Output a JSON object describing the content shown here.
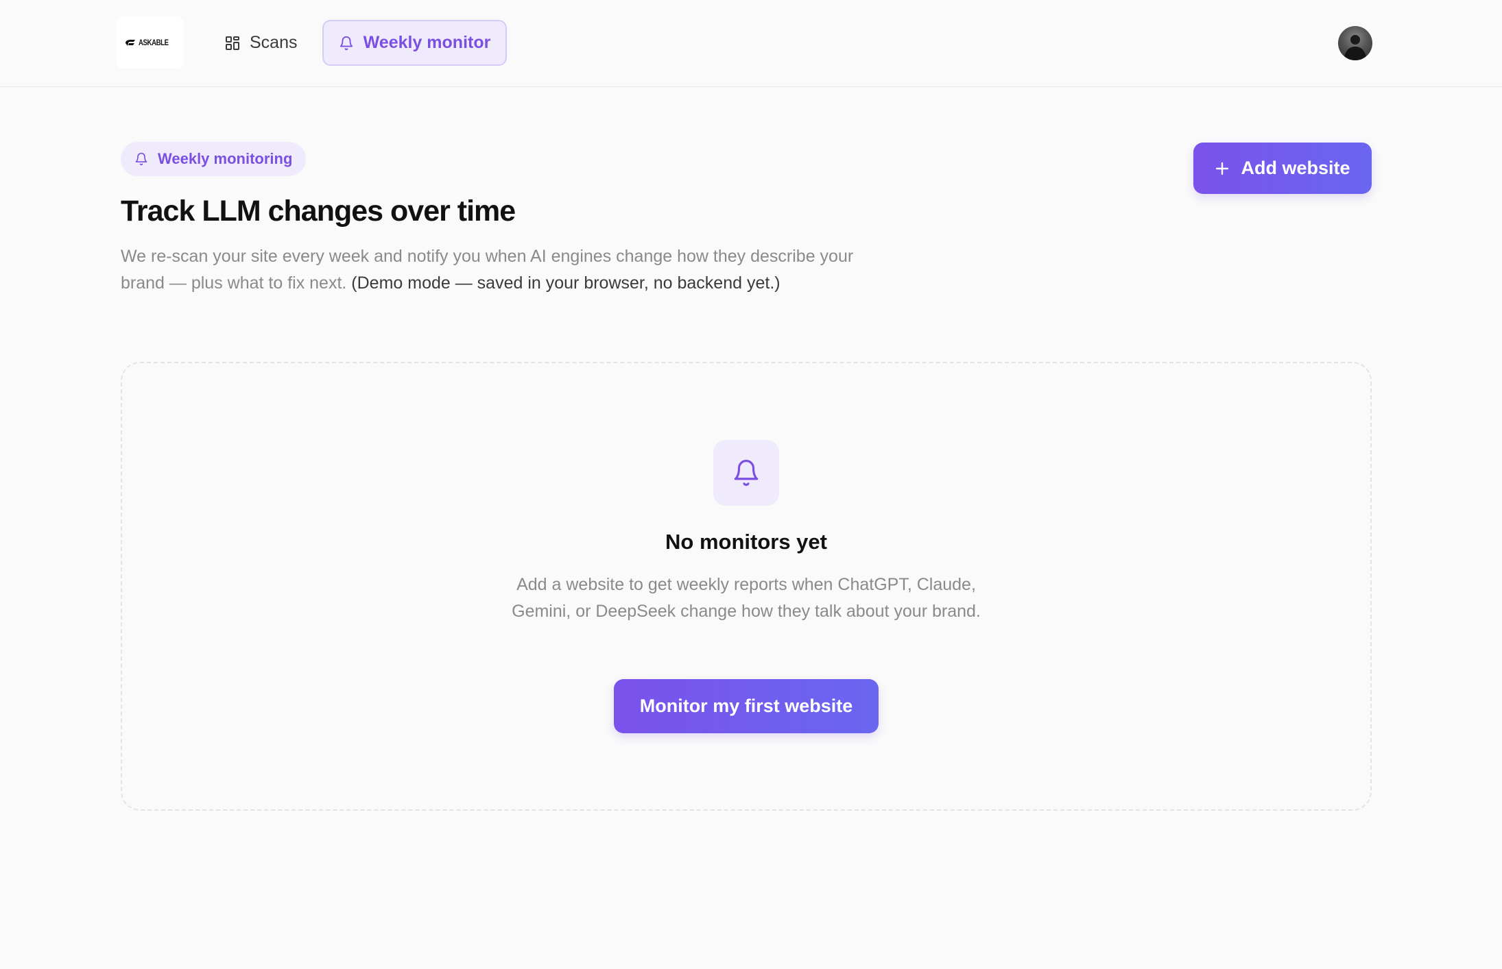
{
  "header": {
    "logo_text": "ASKABLE",
    "nav": {
      "scans_label": "Scans",
      "weekly_monitor_label": "Weekly monitor"
    },
    "icons": {
      "scans": "grid-icon",
      "weekly_monitor": "bell-icon",
      "avatar": "user-avatar"
    }
  },
  "page": {
    "badge_label": "Weekly monitoring",
    "title": "Track LLM changes over time",
    "description": "We re-scan your site every week and notify you when AI engines change how they describe your brand — plus what to fix next.",
    "description_note": "(Demo mode — saved in your browser, no backend yet.)",
    "add_button_label": "Add website"
  },
  "empty_state": {
    "title": "No monitors yet",
    "description": "Add a website to get weekly reports when ChatGPT, Claude, Gemini, or DeepSeek change how they talk about your brand.",
    "button_label": "Monitor my first website"
  },
  "colors": {
    "accent": "#7b4fe0",
    "accent_bg": "#efebfc",
    "button_gradient_start": "#7a52ec",
    "button_gradient_end": "#6a66f0",
    "page_bg": "#fafafa"
  }
}
